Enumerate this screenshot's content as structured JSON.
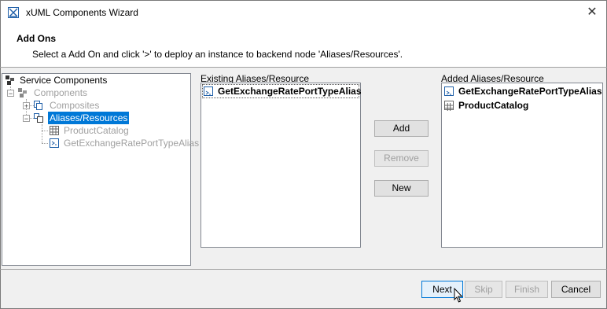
{
  "window": {
    "title": "xUML Components Wizard",
    "close_symbol": "✕"
  },
  "header": {
    "title": "Add Ons",
    "description": "Select a Add On and click '>' to deploy an instance to backend node 'Aliases/Resources'."
  },
  "tree": {
    "items": [
      {
        "label": "Service Components",
        "state": "normal"
      },
      {
        "label": "Components",
        "state": "dim"
      },
      {
        "label": "Composites",
        "state": "dim"
      },
      {
        "label": "Aliases/Resources",
        "state": "selected"
      },
      {
        "label": "ProductCatalog",
        "state": "dim"
      },
      {
        "label": "GetExchangeRatePortTypeAlias",
        "state": "dim"
      }
    ]
  },
  "existing": {
    "label": "Existing Aliases/Resource",
    "items": [
      "GetExchangeRatePortTypeAlias"
    ]
  },
  "added": {
    "label": "Added Aliases/Resource",
    "items": [
      "GetExchangeRatePortTypeAlias",
      "ProductCatalog"
    ]
  },
  "actions": {
    "add": "Add",
    "remove": "Remove",
    "new": "New"
  },
  "footer": {
    "next": "Next",
    "skip": "Skip",
    "finish": "Finish",
    "cancel": "Cancel"
  },
  "colors": {
    "selection": "#0078d7",
    "icon_blue": "#1f5fa8",
    "disabled_text": "#a0a0a0"
  }
}
